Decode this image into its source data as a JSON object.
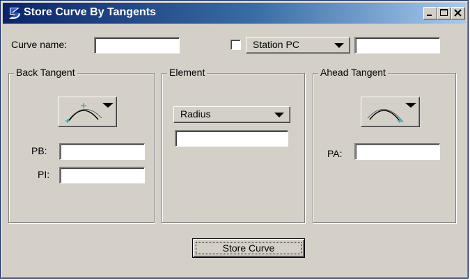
{
  "window": {
    "title": "Store Curve By Tangents",
    "controls": {
      "minimize": "minimize-icon",
      "maximize": "maximize-icon",
      "close": "close-icon"
    }
  },
  "top_row": {
    "curve_name_label": "Curve name:",
    "curve_name_value": "",
    "station_checkbox_checked": false,
    "station_select_value": "Station PC",
    "station_value": ""
  },
  "back_tangent": {
    "title": "Back Tangent",
    "icon": "curve-point-selector-icon",
    "pb_label": "PB:",
    "pb_value": "",
    "pi_label": "PI:",
    "pi_value": ""
  },
  "element": {
    "title": "Element",
    "select_value": "Radius",
    "value": ""
  },
  "ahead_tangent": {
    "title": "Ahead Tangent",
    "icon": "curve-point-selector-icon",
    "pa_label": "PA:",
    "pa_value": ""
  },
  "actions": {
    "store_curve_label": "Store Curve"
  },
  "colors": {
    "dialog_face": "#d4d0c8",
    "title_gradient_start": "#0a246a",
    "title_gradient_end": "#a6caf0",
    "point_marker": "#00c0c0"
  }
}
